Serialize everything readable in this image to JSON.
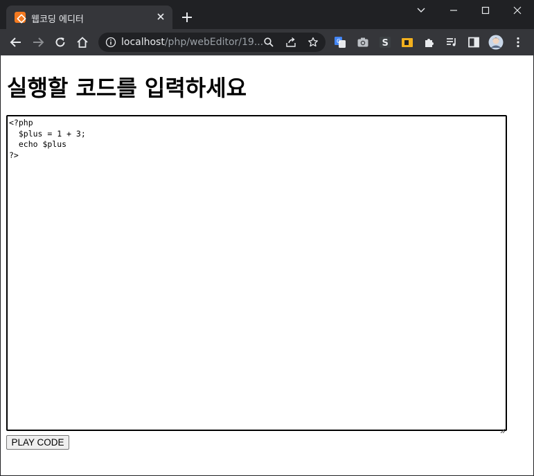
{
  "window": {
    "tab_title": "웹코딩 에디터",
    "tab_favicon": "xampp-favicon-icon",
    "colors": {
      "frame": "#202124",
      "toolbar": "#35363a",
      "favicon": "#f47a20"
    }
  },
  "toolbar": {
    "url_host": "localhost",
    "url_path": "/php/webEditor/19..."
  },
  "page": {
    "heading": "실행할 코드를 입력하세요",
    "code": "<?php\n  $plus = 1 + 3;\n  echo $plus\n?>",
    "play_button": "PLAY CODE"
  }
}
